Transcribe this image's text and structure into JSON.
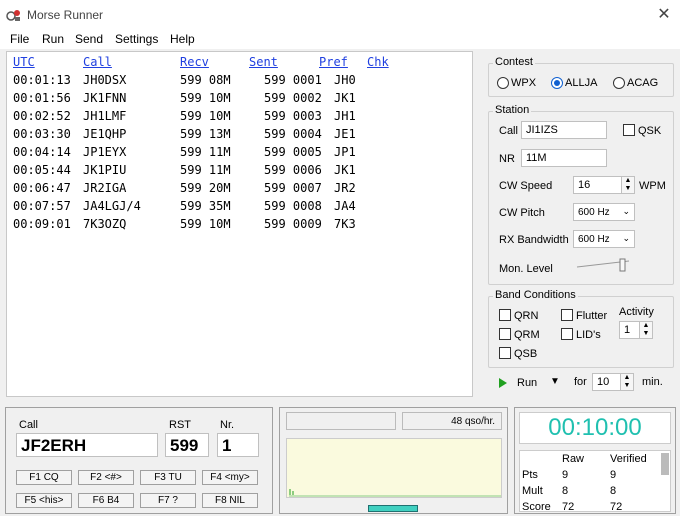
{
  "window": {
    "title": "Morse Runner",
    "close_glyph": "✕"
  },
  "menu": [
    "File",
    "Run",
    "Send",
    "Settings",
    "Help"
  ],
  "log": {
    "headers": [
      "UTC",
      "Call",
      "Recv",
      "Sent",
      "Pref",
      "Chk"
    ],
    "rows": [
      [
        "00:01:13",
        "JH0DSX",
        "599 08M",
        "599 0001",
        "JH0"
      ],
      [
        "00:01:56",
        "JK1FNN",
        "599 10M",
        "599 0002",
        "JK1"
      ],
      [
        "00:02:52",
        "JH1LMF",
        "599 10M",
        "599 0003",
        "JH1"
      ],
      [
        "00:03:30",
        "JE1QHP",
        "599 13M",
        "599 0004",
        "JE1"
      ],
      [
        "00:04:14",
        "JP1EYX",
        "599 11M",
        "599 0005",
        "JP1"
      ],
      [
        "00:05:44",
        "JK1PIU",
        "599 11M",
        "599 0006",
        "JK1"
      ],
      [
        "00:06:47",
        "JR2IGA",
        "599 20M",
        "599 0007",
        "JR2"
      ],
      [
        "00:07:57",
        "JA4LGJ/4",
        "599 35M",
        "599 0008",
        "JA4"
      ],
      [
        "00:09:01",
        "7K3OZQ",
        "599 10M",
        "599 0009",
        "7K3"
      ]
    ]
  },
  "contest": {
    "legend": "Contest",
    "options": [
      "WPX",
      "ALLJA",
      "ACAG"
    ],
    "selected": "ALLJA"
  },
  "station": {
    "legend": "Station",
    "call_label": "Call",
    "call_value": "JI1IZS",
    "qsk_label": "QSK",
    "nr_label": "NR",
    "nr_value": "11M",
    "cw_speed_label": "CW Speed",
    "cw_speed_value": "16",
    "wpm_label": "WPM",
    "cw_pitch_label": "CW Pitch",
    "cw_pitch_value": "600 Hz",
    "rx_bw_label": "RX Bandwidth",
    "rx_bw_value": "600 Hz",
    "mon_level_label": "Mon. Level",
    "mon_level_fraction": 0.9
  },
  "band": {
    "legend": "Band Conditions",
    "qrn": "QRN",
    "flutter": "Flutter",
    "qrm": "QRM",
    "lids": "LID's",
    "qsb": "QSB",
    "activity_label": "Activity",
    "activity_value": "1"
  },
  "run": {
    "run_label": "Run",
    "for_label": "for",
    "minutes_value": "10",
    "min_label": "min."
  },
  "entry": {
    "call_label": "Call",
    "call_value": "JF2ERH",
    "rst_label": "RST",
    "rst_value": "599",
    "nr_label": "Nr.",
    "nr_value": "1"
  },
  "fkeys": [
    "F1 CQ",
    "F2 <#>",
    "F3 TU",
    "F4 <my>",
    "F5 <his>",
    "F6 B4",
    "F7 ?",
    "F8 NIL"
  ],
  "rate": "48 qso/hr.",
  "clock": "00:10:00",
  "score": {
    "cols": [
      "Raw",
      "Verified"
    ],
    "rows": [
      [
        "Pts",
        "9",
        "9"
      ],
      [
        "Mult",
        "8",
        "8"
      ],
      [
        "Score",
        "72",
        "72"
      ]
    ]
  },
  "colors": {
    "link": "#2040e0",
    "clock": "#20c0b0",
    "radio_on": "#1060d0",
    "play": "#20a020"
  }
}
